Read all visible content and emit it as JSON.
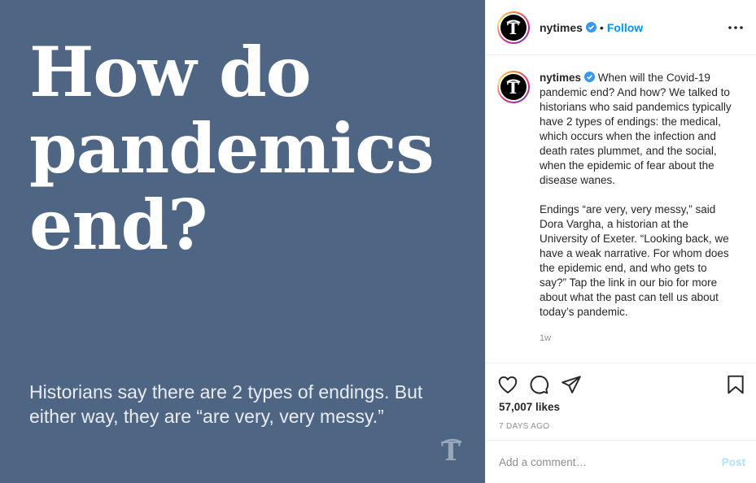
{
  "media": {
    "headline": "How do pandemics end?",
    "subline": "Historians say there are 2 types of endings. But either way, they are “are very, very messy.”",
    "logo_glyph": "𝕋"
  },
  "header": {
    "avatar_glyph": "𝕋",
    "username": "nytimes",
    "separator": "•",
    "follow_label": "Follow",
    "more_icon": "more-horizontal-icon"
  },
  "caption": {
    "username": "nytimes",
    "paragraph1": "When will the Covid-19 pandemic end? And how? We talked to historians who said pandemics typically have 2 types of endings: the medical, which occurs when the infection and death rates plummet, and the social, when the epidemic of fear about the disease wanes.",
    "paragraph2": "Endings “are very, very messy,” said Dora Vargha, a historian at the University of Exeter. “Looking back, we have a weak narrative. For whom does the epidemic end, and who gets to say?” Tap the link in our bio for more about what the past can tell us about today’s pandemic.",
    "time_ago": "1w"
  },
  "actions": {
    "icons": [
      "heart-icon",
      "comment-icon",
      "share-icon",
      "bookmark-icon"
    ]
  },
  "likes_text": "57,007 likes",
  "date_text": "7 DAYS AGO",
  "comment": {
    "placeholder": "Add a comment…",
    "post_label": "Post"
  },
  "colors": {
    "media_bg": "#4f6584",
    "follow": "#0095f6",
    "post_disabled": "#b2dffc",
    "verified": "#3897f0"
  }
}
